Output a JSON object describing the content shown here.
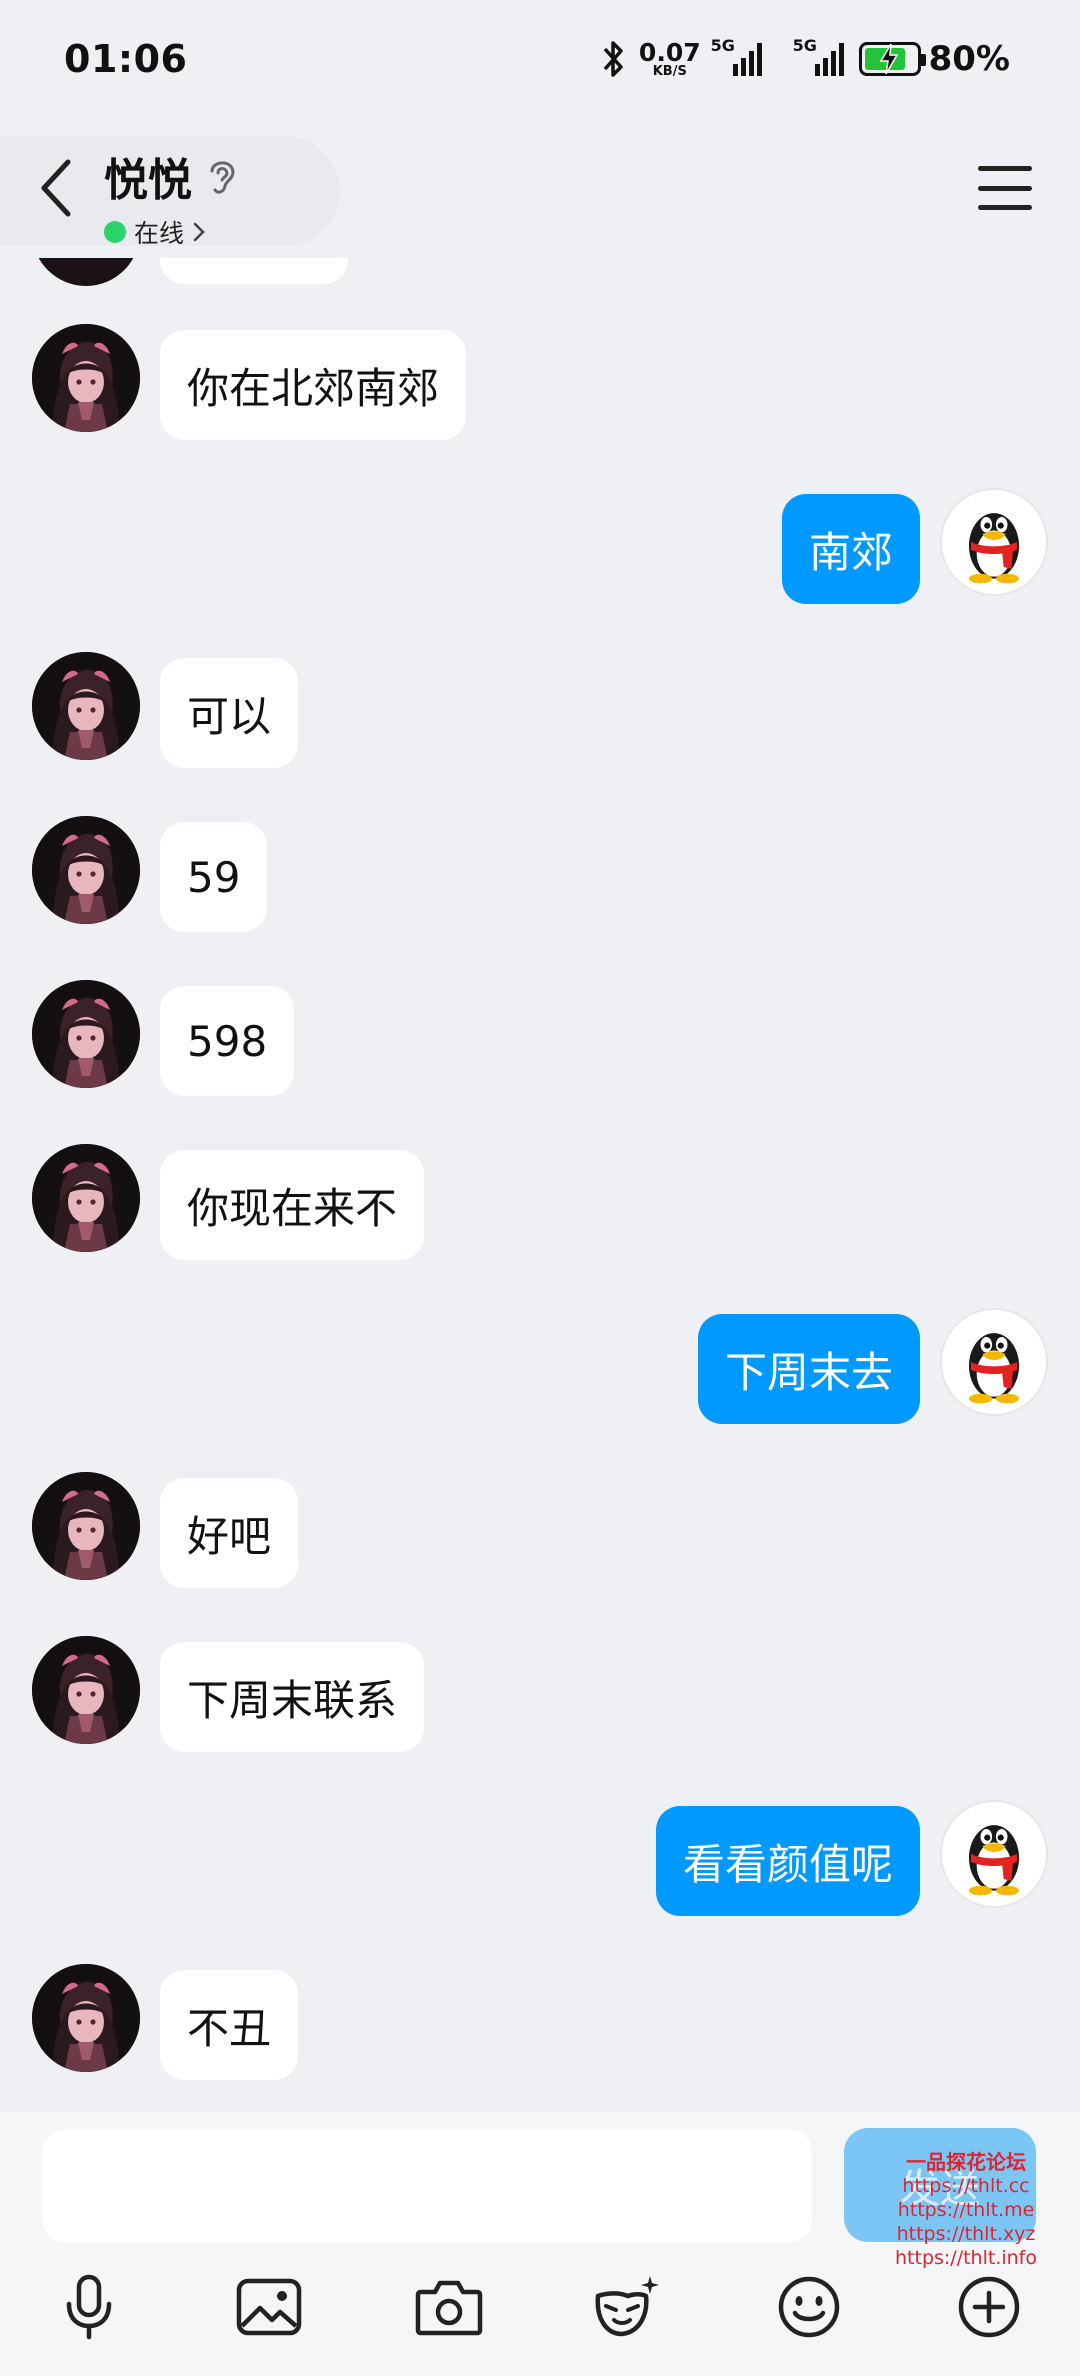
{
  "status_bar": {
    "time": "01:06",
    "net_speed_value": "0.07",
    "net_speed_unit": "KB/S",
    "sim1_label": "5G",
    "sim2_label": "5G",
    "battery_percent": "80%",
    "battery_level": 0.8
  },
  "header": {
    "contact_name": "悦悦",
    "online_status": "在线"
  },
  "messages": [
    {
      "side": "in",
      "text": "你在北郊南郊"
    },
    {
      "side": "out",
      "text": "南郊"
    },
    {
      "side": "in",
      "text": "可以"
    },
    {
      "side": "in",
      "text": "59"
    },
    {
      "side": "in",
      "text": "598"
    },
    {
      "side": "in",
      "text": "你现在来不"
    },
    {
      "side": "out",
      "text": "下周末去"
    },
    {
      "side": "in",
      "text": "好吧"
    },
    {
      "side": "in",
      "text": "下周末联系"
    },
    {
      "side": "out",
      "text": "看看颜值呢"
    },
    {
      "side": "in",
      "text": "不丑"
    }
  ],
  "input": {
    "value": "",
    "send_label": "发送"
  },
  "toolbar": {
    "icons": [
      "microphone-icon",
      "image-icon",
      "camera-icon",
      "sticker-face-icon",
      "emoji-icon",
      "plus-icon"
    ]
  },
  "watermark": {
    "title": "一品探花论坛",
    "urls": [
      "https://thlt.cc",
      "https://thlt.me",
      "https://thlt.xyz",
      "https://thlt.info"
    ]
  },
  "colors": {
    "background": "#eff0f3",
    "outgoing_bubble": "#0099ff",
    "incoming_bubble": "#ffffff",
    "online_dot": "#2bd36b",
    "send_button": "#7cc6f6",
    "watermark": "#e0242e"
  }
}
